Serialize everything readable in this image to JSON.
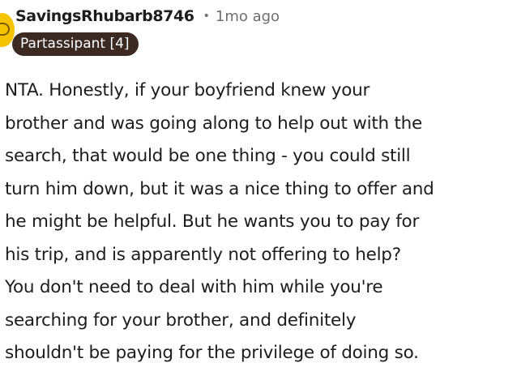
{
  "comment": {
    "author": "SavingsRhubarb8746",
    "separator": "•",
    "timestamp": "1mo ago",
    "flair": "Partassipant [4]",
    "avatar_color": "#f5c400",
    "flair_color": "#3b2a22",
    "body_lines": [
      "NTA. Honestly, if your boyfriend knew your",
      "brother and was going along to help out with the",
      "search, that would be one thing - you could still",
      "turn him down, but it was a nice thing to offer and",
      "he might be helpful. But he wants you to pay for",
      "his trip, and is apparently not offering to help?",
      "You don't need to deal with him while you're",
      "searching for your brother, and definitely",
      "shouldn't be paying for the privilege of doing so."
    ]
  }
}
